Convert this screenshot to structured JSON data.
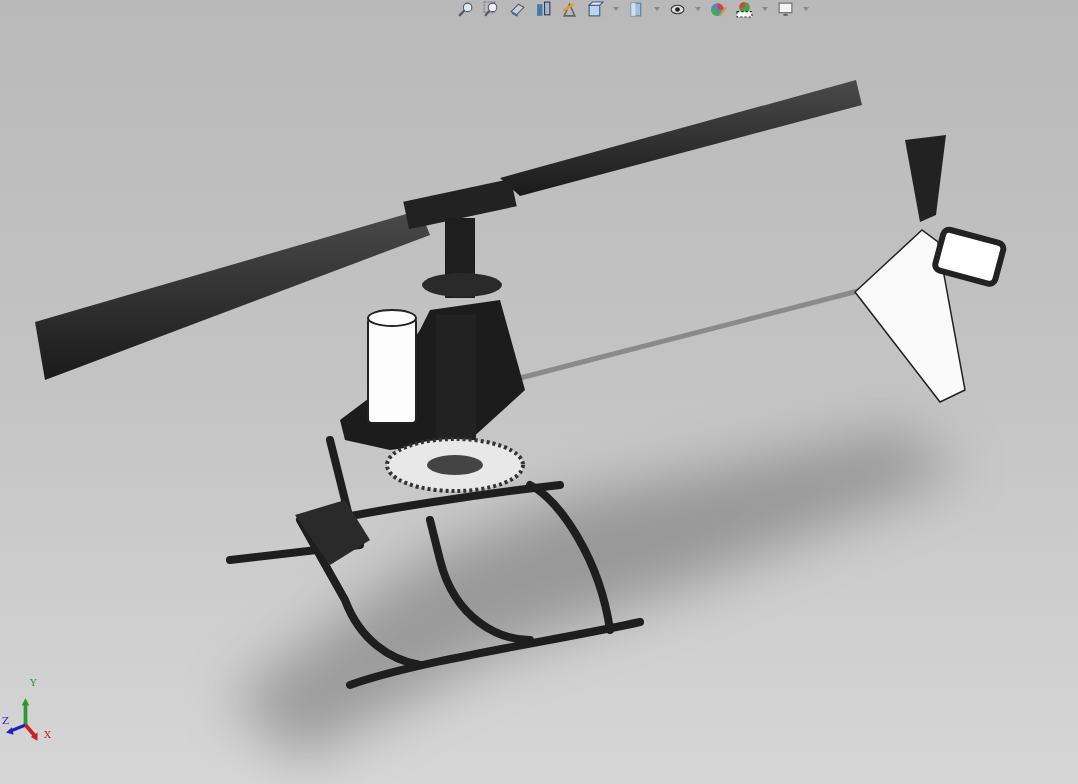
{
  "toolbar": {
    "tools": [
      {
        "kind": "zoom-to-fit",
        "has_menu": false
      },
      {
        "kind": "zoom-to-area",
        "has_menu": false
      },
      {
        "kind": "previous-view",
        "has_menu": false
      },
      {
        "kind": "section-view",
        "has_menu": false
      },
      {
        "kind": "dynamic-annotation",
        "has_menu": false
      },
      {
        "kind": "view-orientation",
        "has_menu": true
      },
      {
        "kind": "display-style",
        "has_menu": true
      },
      {
        "kind": "hide-show",
        "has_menu": true
      },
      {
        "kind": "edit-appearance",
        "has_menu": false
      },
      {
        "kind": "apply-scene",
        "has_menu": true
      },
      {
        "kind": "view-settings",
        "has_menu": true
      }
    ]
  },
  "triad": {
    "axes": [
      {
        "kind": "y",
        "label": "Y"
      },
      {
        "kind": "z",
        "label": "Z"
      },
      {
        "kind": "x",
        "label": "X"
      }
    ]
  }
}
